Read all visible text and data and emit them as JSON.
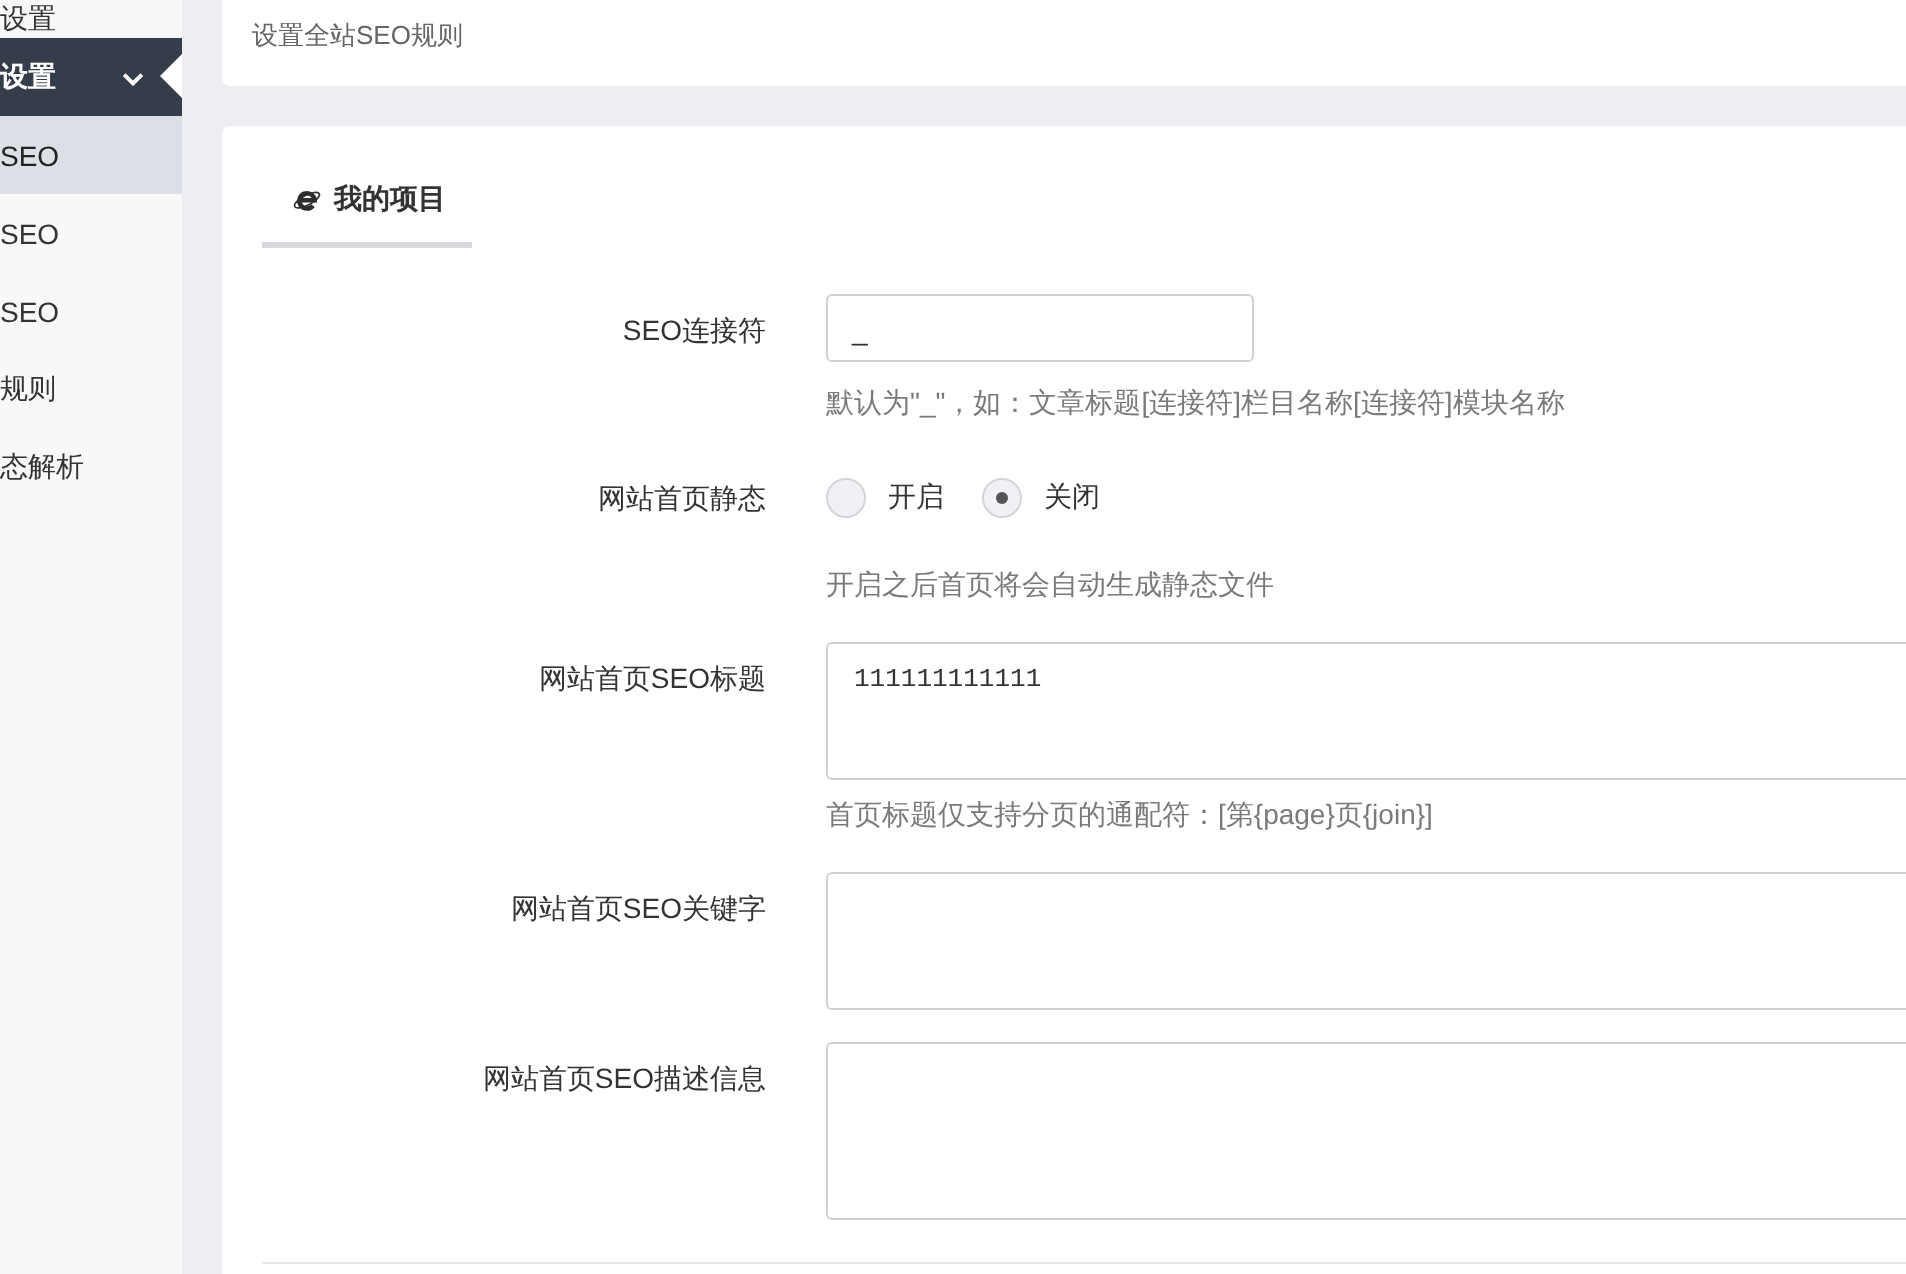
{
  "sidebar": {
    "items": [
      {
        "label": "设置",
        "selected": false,
        "expanded": false
      },
      {
        "label": "设置",
        "selected": true,
        "expanded": true,
        "children": [
          {
            "label": "SEO",
            "selected": true
          },
          {
            "label": "SEO",
            "selected": false
          },
          {
            "label": "SEO",
            "selected": false
          },
          {
            "label": "规则",
            "selected": false
          },
          {
            "label": "态解析",
            "selected": false
          }
        ]
      }
    ]
  },
  "header": {
    "description": "设置全站SEO规则"
  },
  "panel": {
    "tabs": [
      {
        "label": "我的项目",
        "selected": true
      }
    ],
    "fields": [
      {
        "kind": "input",
        "label": "SEO连接符",
        "value": "_",
        "hint": "默认为\"_\"，如：文章标题[连接符]栏目名称[连接符]模块名称"
      },
      {
        "kind": "radio",
        "label": "网站首页静态",
        "options": [
          {
            "label": "开启",
            "selected": false
          },
          {
            "label": "关闭",
            "selected": true
          }
        ],
        "hint": "开启之后首页将会自动生成静态文件"
      },
      {
        "kind": "textarea",
        "label": "网站首页SEO标题",
        "value": "111111111111",
        "hint": "首页标题仅支持分页的通配符：[第{page}页{join}]"
      },
      {
        "kind": "textarea",
        "label": "网站首页SEO关键字"
      },
      {
        "kind": "textarea",
        "label": "网站首页SEO描述信息"
      }
    ]
  }
}
